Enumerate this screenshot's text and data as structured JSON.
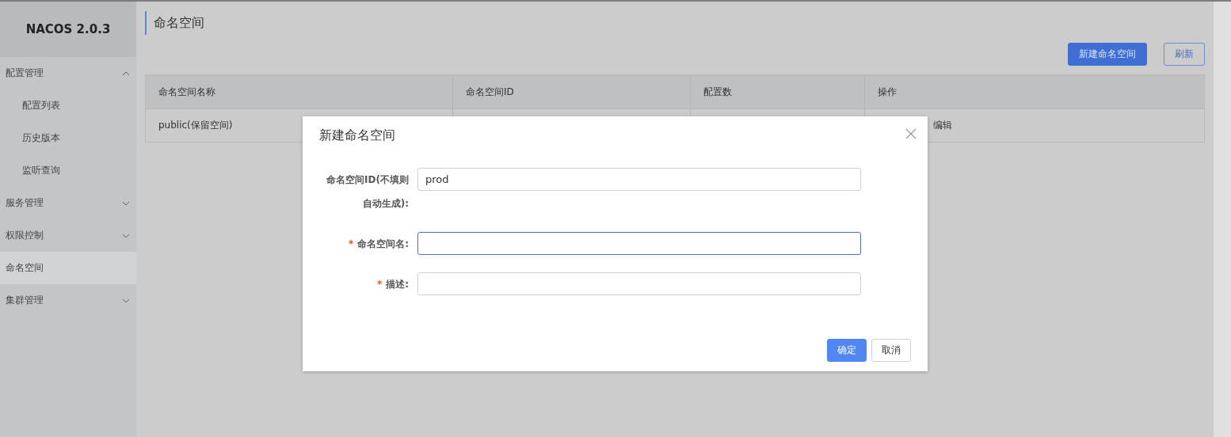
{
  "sidebar": {
    "title": "NACOS 2.0.3",
    "items": [
      {
        "label": "配置管理",
        "expanded": true,
        "selected": false,
        "children": [
          {
            "label": "配置列表",
            "selected": false
          },
          {
            "label": "历史版本",
            "selected": false
          },
          {
            "label": "监听查询",
            "selected": false
          }
        ]
      },
      {
        "label": "服务管理",
        "expanded": false,
        "selected": false
      },
      {
        "label": "权限控制",
        "expanded": false,
        "selected": false
      },
      {
        "label": "命名空间",
        "selected": true
      },
      {
        "label": "集群管理",
        "expanded": false,
        "selected": false
      }
    ]
  },
  "page": {
    "title": "命名空间",
    "buttons": [
      {
        "label": "新建命名空间",
        "kind": "primary"
      },
      {
        "label": "刷新",
        "kind": "secondary"
      }
    ]
  },
  "table": {
    "columns": [
      "命名空间名称",
      "命名空间ID",
      "配置数",
      "操作"
    ],
    "rows": [
      {
        "name": "public(保留空间)",
        "actions": "编辑"
      }
    ]
  },
  "dialog": {
    "title": "新建命名空间",
    "fields": [
      {
        "label": "命名空间ID(不填则自动生成):",
        "value": "prod",
        "focused": false
      },
      {
        "label": "命名空间名:",
        "required_mark": "*",
        "focused": true
      },
      {
        "label": "描述:",
        "required_mark": "*",
        "focused": false
      }
    ],
    "buttons": [
      {
        "label": "确定",
        "kind": "primary"
      },
      {
        "label": "取消",
        "kind": "secondary"
      }
    ]
  }
}
